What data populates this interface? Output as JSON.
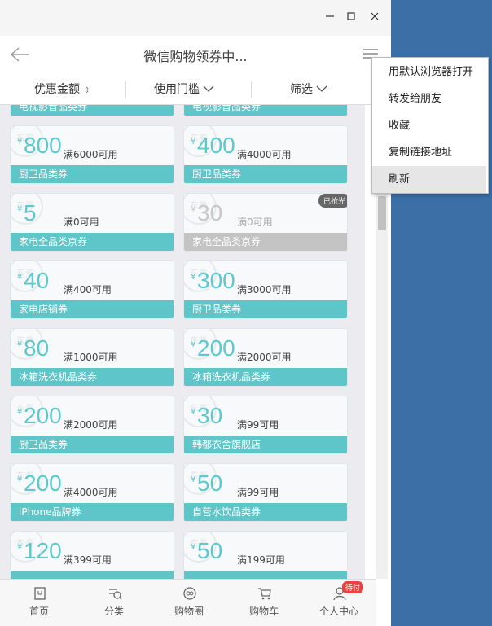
{
  "navbar": {
    "title": "微信购物领券中..."
  },
  "filters": [
    {
      "label": "优惠金额"
    },
    {
      "label": "使用门槛"
    },
    {
      "label": "筛选"
    }
  ],
  "coupons": [
    {
      "amount": "800",
      "cond": "满6000可用",
      "label": "厨卫品类券",
      "col": 0,
      "row": 0
    },
    {
      "amount": "400",
      "cond": "满4000可用",
      "label": "厨卫品类券",
      "col": 1,
      "row": 0
    },
    {
      "amount": "5",
      "cond": "满0可用",
      "label": "家电全品类京券",
      "col": 0,
      "row": 1
    },
    {
      "amount": "30",
      "cond": "满0可用",
      "label": "家电全品类京券",
      "col": 1,
      "row": 1,
      "gray": true,
      "badge": "已抢光"
    },
    {
      "amount": "40",
      "cond": "满400可用",
      "label": "家电店铺券",
      "col": 0,
      "row": 2
    },
    {
      "amount": "300",
      "cond": "满3000可用",
      "label": "厨卫品类券",
      "col": 1,
      "row": 2
    },
    {
      "amount": "80",
      "cond": "满1000可用",
      "label": "冰箱洗衣机品类券",
      "col": 0,
      "row": 3
    },
    {
      "amount": "200",
      "cond": "满2000可用",
      "label": "冰箱洗衣机品类券",
      "col": 1,
      "row": 3
    },
    {
      "amount": "200",
      "cond": "满2000可用",
      "label": "厨卫品类券",
      "col": 0,
      "row": 4
    },
    {
      "amount": "30",
      "cond": "满99可用",
      "label": "韩都衣舍旗舰店",
      "col": 1,
      "row": 4
    },
    {
      "amount": "200",
      "cond": "满4000可用",
      "label": "iPhone品牌券",
      "col": 0,
      "row": 5
    },
    {
      "amount": "50",
      "cond": "满99可用",
      "label": "自营水饮品类券",
      "col": 1,
      "row": 5
    },
    {
      "amount": "120",
      "cond": "满399可用",
      "label": "",
      "col": 0,
      "row": 6
    },
    {
      "amount": "50",
      "cond": "满199可用",
      "label": "",
      "col": 1,
      "row": 6
    }
  ],
  "partial_top": {
    "left": "电视影音品类券",
    "right": "电视影音品类券"
  },
  "coupon_stamp": "东券",
  "currency": "¥",
  "tabs": [
    {
      "label": "首页",
      "icon": "home-icon"
    },
    {
      "label": "分类",
      "icon": "category-icon"
    },
    {
      "label": "购物圈",
      "icon": "circle-icon"
    },
    {
      "label": "购物车",
      "icon": "cart-icon"
    },
    {
      "label": "个人中心",
      "icon": "user-icon"
    }
  ],
  "tab_badge": "待付",
  "context_menu": [
    "用默认浏览器打开",
    "转发给朋友",
    "收藏",
    "复制链接地址",
    "刷新"
  ],
  "colors": {
    "accent": "#5ec5c8",
    "desktop": "#3b6fa6"
  }
}
